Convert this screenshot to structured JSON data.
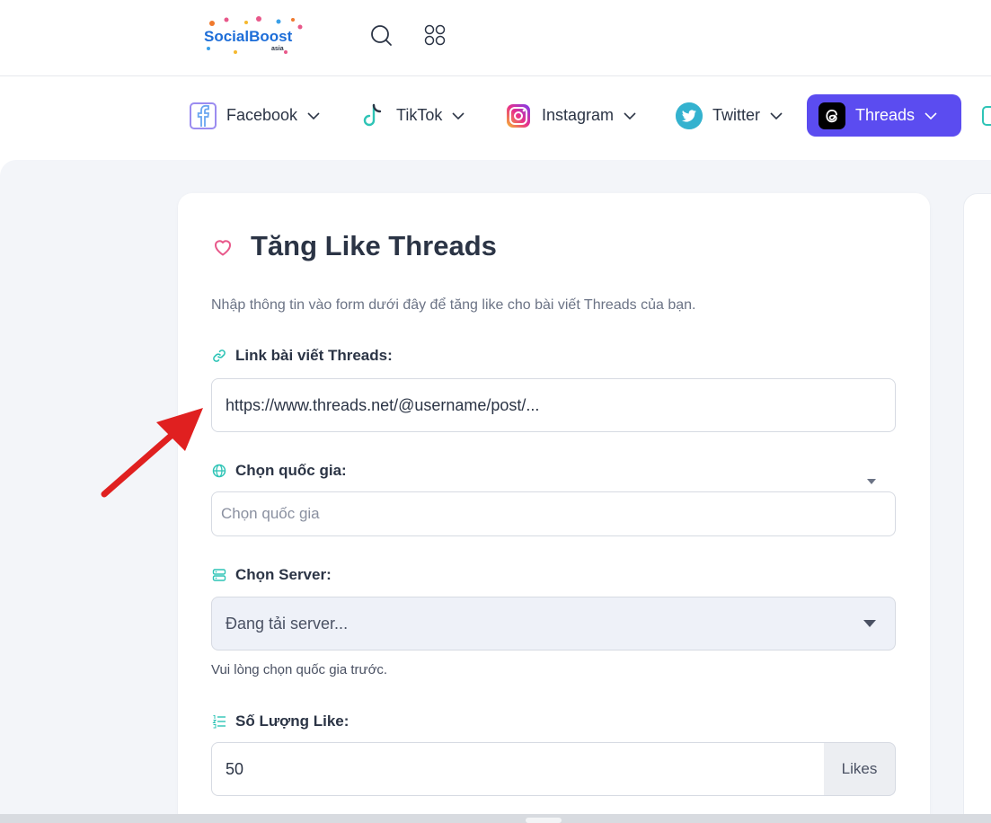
{
  "header": {
    "logo_text": "SocialBoost",
    "logo_sub": "asia",
    "search_icon": "search-icon",
    "apps_icon": "apps-icon"
  },
  "nav": {
    "items": [
      {
        "label": "Facebook",
        "icon": "facebook-icon"
      },
      {
        "label": "TikTok",
        "icon": "tiktok-icon"
      },
      {
        "label": "Instagram",
        "icon": "instagram-icon"
      },
      {
        "label": "Twitter",
        "icon": "twitter-icon"
      },
      {
        "label": "Threads",
        "icon": "threads-icon",
        "active": true
      }
    ],
    "active_color": "#5b4cf0"
  },
  "form": {
    "title": "Tăng Like Threads",
    "description": "Nhập thông tin vào form dưới đây để tăng like cho bài viết Threads của bạn.",
    "link_label": "Link bài viết Threads:",
    "link_value": "https://www.threads.net/@username/post/...",
    "country_label": "Chọn quốc gia:",
    "country_placeholder": "Chọn quốc gia",
    "server_label": "Chọn Server:",
    "server_value": "Đang tải server...",
    "server_hint": "Vui lòng chọn quốc gia trước.",
    "quantity_label": "Số Lượng Like:",
    "quantity_value": "50",
    "quantity_unit": "Likes"
  },
  "colors": {
    "accent_teal": "#2ec4b6",
    "heart_pink": "#e8588a",
    "arrow_red": "#e02020"
  }
}
